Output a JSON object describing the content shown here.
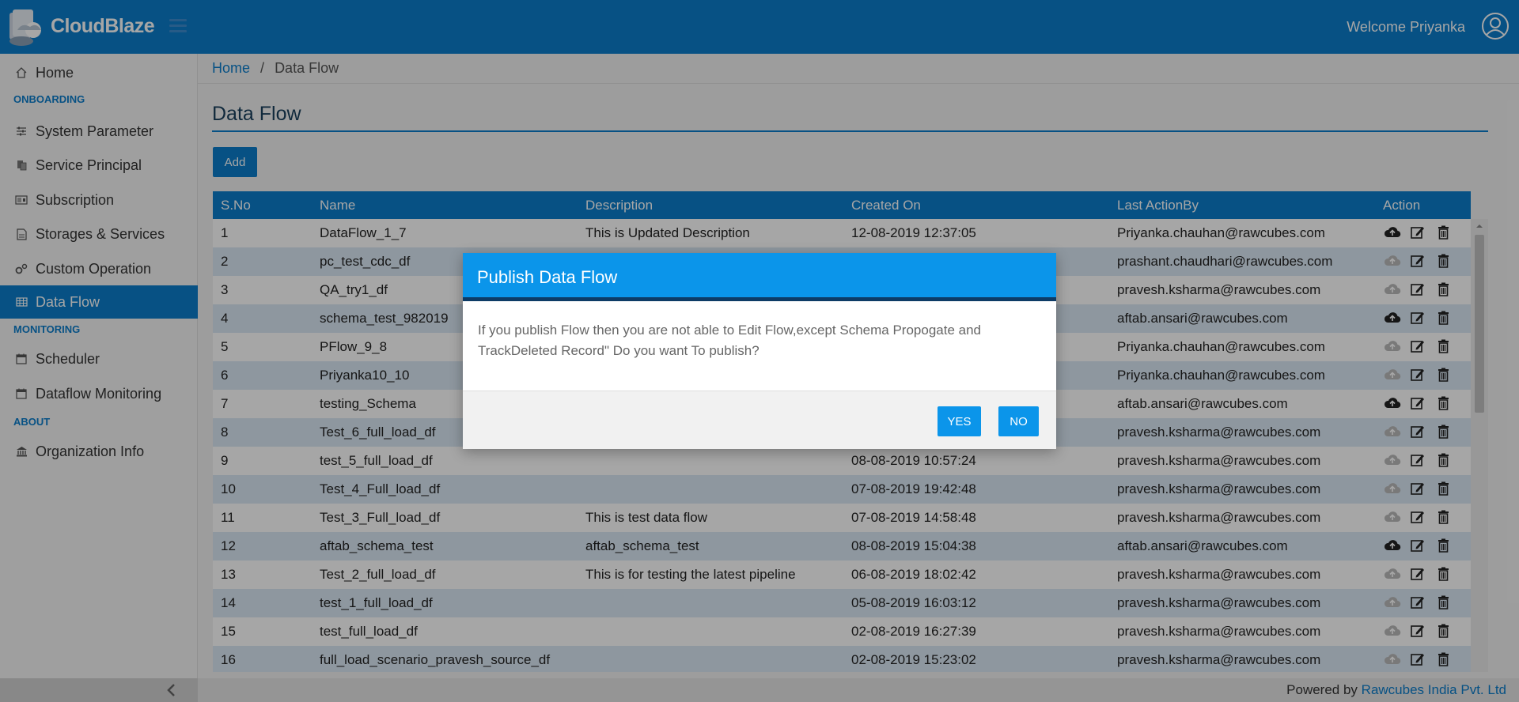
{
  "header": {
    "brand": "CloudBlaze",
    "welcome": "Welcome Priyanka"
  },
  "sidebar": {
    "home": "Home",
    "sections": {
      "onboarding": "ONBOARDING",
      "monitoring": "MONITORING",
      "about": "ABOUT"
    },
    "items": {
      "system_parameter": "System Parameter",
      "service_principal": "Service Principal",
      "subscription": "Subscription",
      "storages": "Storages & Services",
      "custom_operation": "Custom Operation",
      "data_flow": "Data Flow",
      "scheduler": "Scheduler",
      "dataflow_monitoring": "Dataflow Monitoring",
      "organization_info": "Organization Info"
    }
  },
  "breadcrumb": {
    "home": "Home",
    "separator": "/",
    "current": "Data Flow"
  },
  "page": {
    "title": "Data Flow",
    "add_label": "Add"
  },
  "table": {
    "headers": [
      "S.No",
      "Name",
      "Description",
      "Created On",
      "Last ActionBy",
      "Action"
    ],
    "rows": [
      {
        "sno": "1",
        "name": "DataFlow_1_7",
        "desc": "This is Updated Description",
        "created": "12-08-2019 12:37:05",
        "by": "Priyanka.chauhan@rawcubes.com",
        "publish_active": true
      },
      {
        "sno": "2",
        "name": "pc_test_cdc_df",
        "desc": "",
        "created": "",
        "by": "prashant.chaudhari@rawcubes.com",
        "publish_active": false
      },
      {
        "sno": "3",
        "name": "QA_try1_df",
        "desc": "",
        "created": "",
        "by": "pravesh.ksharma@rawcubes.com",
        "publish_active": false
      },
      {
        "sno": "4",
        "name": "schema_test_982019",
        "desc": "",
        "created": "",
        "by": "aftab.ansari@rawcubes.com",
        "publish_active": true
      },
      {
        "sno": "5",
        "name": "PFlow_9_8",
        "desc": "",
        "created": "",
        "by": "Priyanka.chauhan@rawcubes.com",
        "publish_active": false
      },
      {
        "sno": "6",
        "name": "Priyanka10_10",
        "desc": "",
        "created": "",
        "by": "Priyanka.chauhan@rawcubes.com",
        "publish_active": false
      },
      {
        "sno": "7",
        "name": "testing_Schema",
        "desc": "",
        "created": "",
        "by": "aftab.ansari@rawcubes.com",
        "publish_active": true
      },
      {
        "sno": "8",
        "name": "Test_6_full_load_df",
        "desc": "",
        "created": "",
        "by": "pravesh.ksharma@rawcubes.com",
        "publish_active": false
      },
      {
        "sno": "9",
        "name": "test_5_full_load_df",
        "desc": "",
        "created": "08-08-2019 10:57:24",
        "by": "pravesh.ksharma@rawcubes.com",
        "publish_active": false
      },
      {
        "sno": "10",
        "name": "Test_4_Full_load_df",
        "desc": "",
        "created": "07-08-2019 19:42:48",
        "by": "pravesh.ksharma@rawcubes.com",
        "publish_active": false
      },
      {
        "sno": "11",
        "name": "Test_3_Full_load_df",
        "desc": "This is test data flow",
        "created": "07-08-2019 14:58:48",
        "by": "pravesh.ksharma@rawcubes.com",
        "publish_active": false
      },
      {
        "sno": "12",
        "name": "aftab_schema_test",
        "desc": "aftab_schema_test",
        "created": "08-08-2019 15:04:38",
        "by": "aftab.ansari@rawcubes.com",
        "publish_active": true
      },
      {
        "sno": "13",
        "name": "Test_2_full_load_df",
        "desc": "This is for testing the latest pipeline",
        "created": "06-08-2019 18:02:42",
        "by": "pravesh.ksharma@rawcubes.com",
        "publish_active": false
      },
      {
        "sno": "14",
        "name": "test_1_full_load_df",
        "desc": "",
        "created": "05-08-2019 16:03:12",
        "by": "pravesh.ksharma@rawcubes.com",
        "publish_active": false
      },
      {
        "sno": "15",
        "name": "test_full_load_df",
        "desc": "",
        "created": "02-08-2019 16:27:39",
        "by": "pravesh.ksharma@rawcubes.com",
        "publish_active": false
      },
      {
        "sno": "16",
        "name": "full_load_scenario_pravesh_source_df",
        "desc": "",
        "created": "02-08-2019 15:23:02",
        "by": "pravesh.ksharma@rawcubes.com",
        "publish_active": false
      }
    ]
  },
  "footer": {
    "prefix": "Powered by",
    "company": "Rawcubes India Pvt. Ltd"
  },
  "modal": {
    "title": "Publish Data Flow",
    "body": "If you publish Flow then you are not able to Edit Flow,except Schema Propogate and TrackDeleted Record\" Do you want To publish?",
    "yes_label": "YES",
    "no_label": "NO"
  },
  "colors": {
    "primary": "#0b7dcb",
    "modal_header": "#0b95ea",
    "modal_header_border": "#0d3b66",
    "row_alt": "#dbe8f4"
  },
  "icons": [
    "cloud-upload-icon",
    "edit-icon",
    "trash-icon",
    "home-icon",
    "user-avatar-icon",
    "menu-icon"
  ]
}
